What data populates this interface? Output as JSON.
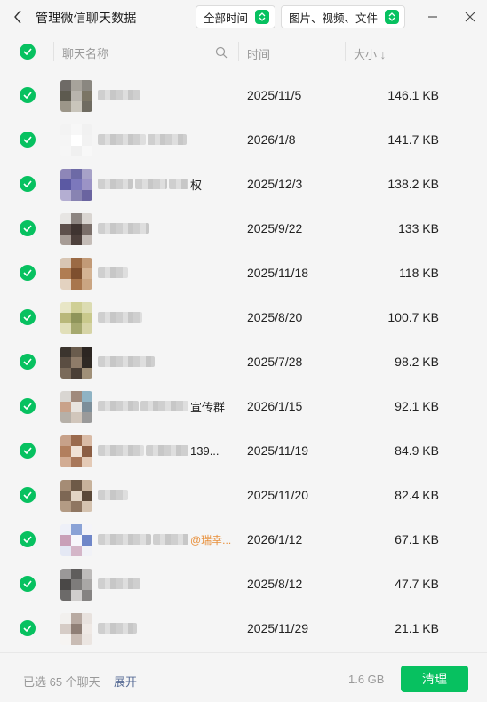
{
  "window": {
    "title": "管理微信聊天数据",
    "filter_time": "全部时间",
    "filter_type": "图片、视频、文件",
    "accent": "#07c160"
  },
  "table": {
    "columns": {
      "name": "聊天名称",
      "time": "时间",
      "size": "大小 ↓"
    },
    "rows": [
      {
        "name_tail": "",
        "time": "2025/11/5",
        "size": "146.1 KB",
        "avatar": [
          "#6e6a66",
          "#a7a39b",
          "#8a8780",
          "#5d5a4f",
          "#b8b4ad",
          "#7b7565",
          "#9c9689",
          "#c9c5bb",
          "#6f6b61"
        ]
      },
      {
        "name_tail": "",
        "time": "2026/1/8",
        "size": "141.7 KB",
        "avatar": [
          "#f3f3f3",
          "#f7f7f7",
          "#f1f1f1",
          "#f5f5f5",
          "#ffffff",
          "#f2f2f2",
          "#f6f6f6",
          "#f0f0f0",
          "#f8f8f8"
        ]
      },
      {
        "name_tail": "权",
        "time": "2025/12/3",
        "size": "138.2 KB",
        "avatar": [
          "#8e86b8",
          "#6d6aa6",
          "#a7a2c8",
          "#5b59a3",
          "#7c78bc",
          "#9b93c6",
          "#b4aed2",
          "#8883b2",
          "#6a64a0"
        ]
      },
      {
        "name_tail": "",
        "time": "2025/9/22",
        "size": "133 KB",
        "avatar": [
          "#e7e5e3",
          "#8d8581",
          "#d9d5d1",
          "#5e504c",
          "#3f3431",
          "#7a6e69",
          "#a79c96",
          "#4d403c",
          "#c4bcb7"
        ]
      },
      {
        "name_tail": "",
        "time": "2025/11/18",
        "size": "118 KB",
        "avatar": [
          "#d8c6b4",
          "#9b6a44",
          "#c29a77",
          "#b07d52",
          "#7e4f2e",
          "#d4b393",
          "#e3d2c0",
          "#a8764d",
          "#caa582"
        ]
      },
      {
        "name_tail": "",
        "time": "2025/8/20",
        "size": "100.7 KB",
        "avatar": [
          "#e8e6c6",
          "#cfcf95",
          "#dcdcb2",
          "#b9b87a",
          "#8f955a",
          "#c9c98c",
          "#e1dfb9",
          "#a6a96f",
          "#d6d4a6"
        ]
      },
      {
        "name_tail": "",
        "time": "2025/7/28",
        "size": "98.2 KB",
        "avatar": [
          "#3b342e",
          "#6a5c4d",
          "#2c2622",
          "#5a4d42",
          "#8f7c69",
          "#2f2924",
          "#7a6a5a",
          "#4a3f36",
          "#a09078"
        ]
      },
      {
        "name_tail": "宣传群",
        "time": "2026/1/15",
        "size": "92.1 KB",
        "avatar": [
          "#d9d6d2",
          "#a08a7c",
          "#8fb3c4",
          "#c9a28a",
          "#e8e4df",
          "#7c8e9a",
          "#b6b0a8",
          "#d1c6bb",
          "#9a9a9a"
        ]
      },
      {
        "name_tail": "139...",
        "time": "2025/11/19",
        "size": "84.9 KB",
        "avatar": [
          "#c7a189",
          "#9a6a4d",
          "#d9bba6",
          "#b27f5e",
          "#f0e2d6",
          "#8c5e44",
          "#d2ac93",
          "#a8775a",
          "#e4cab6"
        ]
      },
      {
        "name_tail": "",
        "time": "2025/11/20",
        "size": "82.4 KB",
        "avatar": [
          "#a58c75",
          "#6e5a47",
          "#c7b29b",
          "#7d6754",
          "#e2d4c4",
          "#5a4838",
          "#b39b84",
          "#8f7661",
          "#d5c3b0"
        ]
      },
      {
        "name_tail": "@瑞幸...",
        "time": "2026/1/12",
        "size": "67.1 KB",
        "avatar": [
          "#eef0f8",
          "#8aa2d6",
          "#f4f4f8",
          "#c9a0b8",
          "#f7f7fb",
          "#6f86c8",
          "#e4e8f4",
          "#d4b6c8",
          "#f1f2f7"
        ]
      },
      {
        "name_tail": "",
        "time": "2025/8/12",
        "size": "47.7 KB",
        "avatar": [
          "#9a9898",
          "#5f5d5c",
          "#bdbbba",
          "#4a4847",
          "#7e7c7b",
          "#a9a7a6",
          "#6c6a69",
          "#d0cecd",
          "#858382"
        ]
      },
      {
        "name_tail": "",
        "time": "2025/11/29",
        "size": "21.1 KB",
        "avatar": [
          "#f2f0ee",
          "#b8aaa2",
          "#e8e2de",
          "#d6ccc6",
          "#8f7f76",
          "#efe9e5",
          "#f6f4f2",
          "#c9bcb4",
          "#ebe5e1"
        ]
      }
    ]
  },
  "footer": {
    "selected": "已选 65 个聊天",
    "expand": "展开",
    "total": "1.6 GB",
    "clean": "清理"
  }
}
